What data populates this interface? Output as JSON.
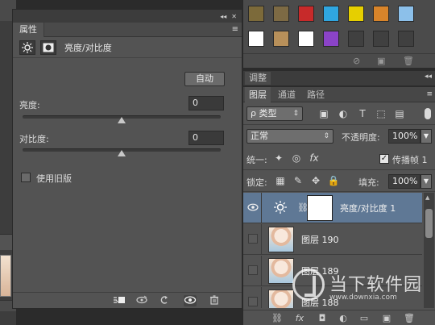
{
  "properties_panel": {
    "collapse_glyph": "◂◂",
    "close_glyph": "✕",
    "tab_label": "属性",
    "menu_glyph": "≡",
    "adjustment_name": "亮度/对比度",
    "auto_button": "自动",
    "brightness": {
      "label": "亮度:",
      "value": "0",
      "level": 0.5
    },
    "contrast": {
      "label": "对比度:",
      "value": "0",
      "level": 0.5
    },
    "legacy_checkbox": {
      "label": "使用旧版",
      "checked": false
    },
    "bottom_icons": [
      "clip-to-layer-icon",
      "view-previous-state-icon",
      "reset-icon",
      "toggle-visibility-icon",
      "delete-icon"
    ]
  },
  "swatches_panel": {
    "swatch_colors": [
      "#7c6a3a",
      "#7d6a44",
      "#c72a2a",
      "#2fa6e0",
      "#e6cf00",
      "#d8842a",
      "#8cc0ea",
      "#ffffff",
      "#b8905a",
      "#ffffff",
      "#8b43c8",
      "#404040",
      "#404040",
      "#404040"
    ],
    "bottom_icons": [
      "no-icon",
      "new-swatch-icon",
      "delete-icon"
    ]
  },
  "adjustments_tab": {
    "label": "调整",
    "collapse_glyph": "◂◂"
  },
  "layers_panel": {
    "tabs": [
      "图层",
      "通道",
      "路径"
    ],
    "active_tab": 0,
    "menu_glyph": "≡",
    "filter_kind": "ρ 类型",
    "blend_mode": "正常",
    "opacity_label": "不透明度:",
    "opacity_value": "100%",
    "unify_label": "统一:",
    "propagate_label": "传播帧 1",
    "lock_label": "锁定:",
    "fill_label": "填充:",
    "fill_value": "100%",
    "layers": [
      {
        "name": "亮度/对比度 1",
        "type": "adjustment",
        "visible": true,
        "selected": true
      },
      {
        "name": "图层 190",
        "type": "image",
        "visible": false,
        "selected": false
      },
      {
        "name": "图层 189",
        "type": "image",
        "visible": false,
        "selected": false
      },
      {
        "name": "图层 188",
        "type": "image",
        "visible": false,
        "selected": false
      }
    ],
    "bottom_icons": [
      "link-icon",
      "fx-icon",
      "mask-icon",
      "adjustment-icon",
      "folder-icon",
      "new-layer-icon",
      "delete-icon"
    ]
  },
  "watermark": {
    "name": "当下软件园",
    "url": "www.downxia.com"
  }
}
